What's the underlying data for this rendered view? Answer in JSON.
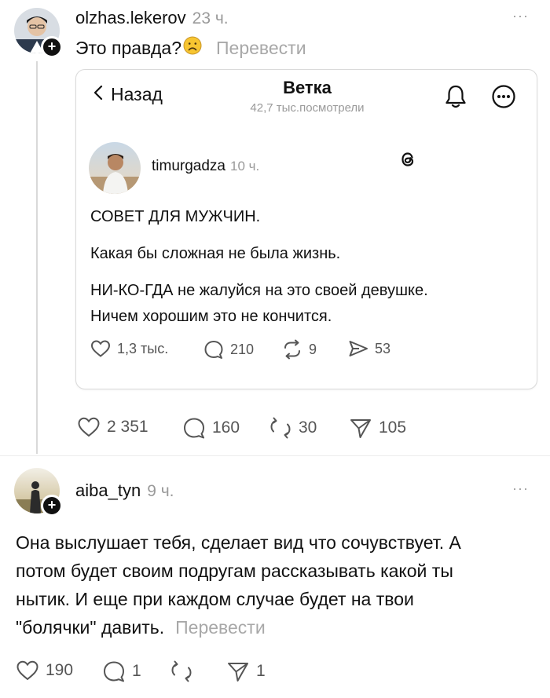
{
  "post": {
    "username": "olzhas.lekerov",
    "time": "23 ч.",
    "text": "Это правда?",
    "emoji": "☹",
    "translate_label": "Перевести",
    "more": "···",
    "stats": {
      "likes": "2 351",
      "replies": "160",
      "reposts": "30",
      "shares": "105"
    }
  },
  "embedded_screenshot": {
    "back_label": "Назад",
    "title": "Ветка",
    "views": "42,7 тыс.посмотрели",
    "author": "timurgadza",
    "time": "10 ч.",
    "line1": "СОВЕТ ДЛЯ МУЖЧИН.",
    "line2": "Какая бы сложная не была жизнь.",
    "line3": "НИ-КО-ГДА не жалуйся на это своей девушке.",
    "line4": "Ничем хорошим это не кончится.",
    "stats": {
      "likes": "1,3 тыс.",
      "replies": "210",
      "reposts": "9",
      "shares": "53"
    }
  },
  "reply": {
    "username": "aiba_tyn",
    "time": "9 ч.",
    "more": "···",
    "lines": [
      "Она выслушает тебя, сделает вид что сочувствует. А",
      "потом будет своим подругам рассказывать какой ты",
      "нытик. И еще при каждом случае будет на твои",
      "\"болячки\" давить."
    ],
    "translate_label": "Перевести",
    "stats": {
      "likes": "190",
      "replies": "1",
      "reposts": "",
      "shares": "1"
    }
  }
}
